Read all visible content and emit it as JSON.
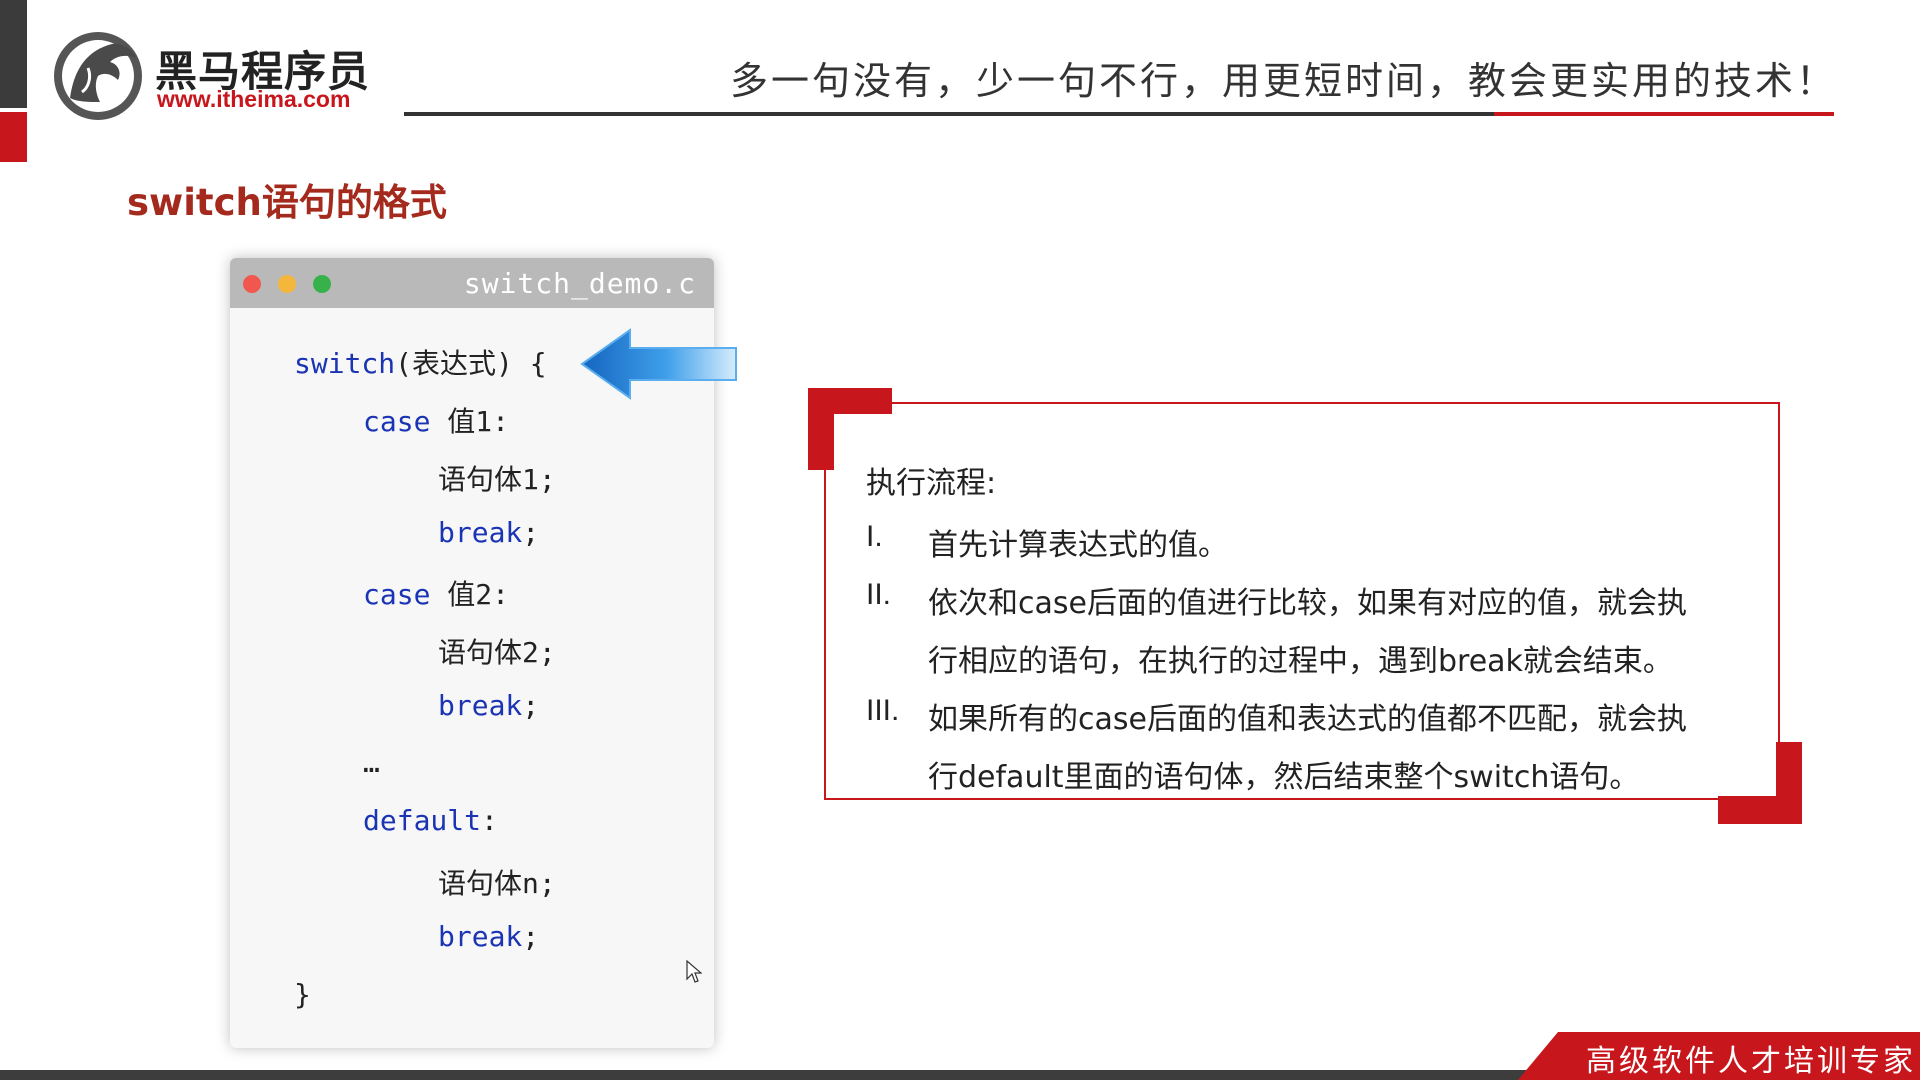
{
  "header": {
    "brand_cn": "黑马程序员",
    "brand_url": "www.itheima.com",
    "slogan": "多一句没有，少一句不行，用更短时间，教会更实用的技术！"
  },
  "slide": {
    "title": "switch语句的格式"
  },
  "code_window": {
    "filename": "switch_demo.c",
    "lines": [
      {
        "kw": "switch",
        "rest": "(表达式) {"
      },
      {
        "kw": "case",
        "rest": " 值1:"
      },
      {
        "kw": "",
        "rest": "语句体1;"
      },
      {
        "kw": "break",
        "rest": ";"
      },
      {
        "kw": "case",
        "rest": " 值2:"
      },
      {
        "kw": "",
        "rest": "语句体2;"
      },
      {
        "kw": "break",
        "rest": ";"
      },
      {
        "kw": "",
        "rest": "…"
      },
      {
        "kw": "default",
        "rest": ":"
      },
      {
        "kw": "",
        "rest": "语句体n;"
      },
      {
        "kw": "break",
        "rest": ";"
      },
      {
        "kw": "",
        "rest": "}"
      }
    ]
  },
  "info_box": {
    "title": "执行流程:",
    "items": [
      {
        "num": "I.",
        "lines": [
          "首先计算表达式的值。"
        ]
      },
      {
        "num": "II.",
        "lines": [
          "依次和case后面的值进行比较，如果有对应的值，就会执",
          "行相应的语句，在执行的过程中，遇到break就会结束。"
        ]
      },
      {
        "num": "III.",
        "lines": [
          "如果所有的case后面的值和表达式的值都不匹配，就会执",
          "行default里面的语句体，然后结束整个switch语句。"
        ]
      }
    ]
  },
  "footer": {
    "badge_text": "高级软件人才培训专家"
  },
  "colors": {
    "accent_red": "#c8161d",
    "title_red": "#a32a1c",
    "keyword_blue": "#1a34b4",
    "arrow_blue": "#1f7fd6"
  },
  "icons": {
    "logo": "horse-logo-icon",
    "arrow": "left-arrow-icon",
    "cursor": "mouse-pointer-icon"
  }
}
